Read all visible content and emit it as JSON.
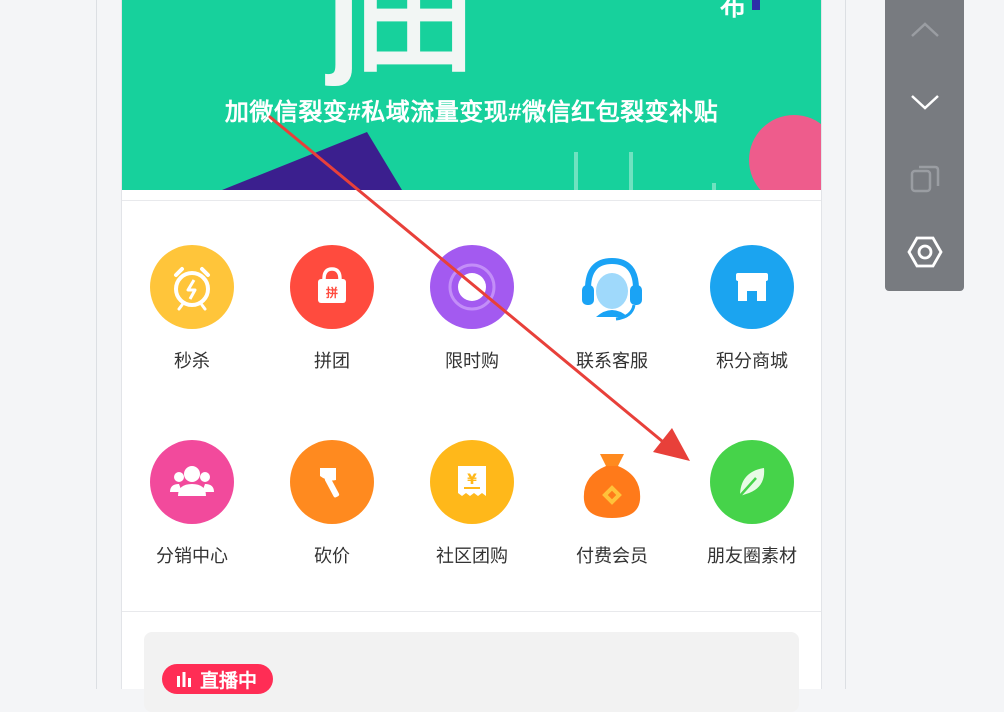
{
  "banner": {
    "big_text": "j田",
    "corner_text": "布",
    "tagline": "加微信裂变#私域流量变现#微信红包裂变补贴"
  },
  "grid": [
    {
      "label": "秒杀",
      "icon": "alarm-clock-icon",
      "color": "#ffc53a"
    },
    {
      "label": "拼团",
      "icon": "shopping-bag-icon",
      "color": "#ff4b3e"
    },
    {
      "label": "限时购",
      "icon": "clock-icon",
      "color": "#a35af0"
    },
    {
      "label": "联系客服",
      "icon": "headset-icon",
      "color": "#1aa3f5"
    },
    {
      "label": "积分商城",
      "icon": "store-icon",
      "color": "#1ba4f0"
    },
    {
      "label": "分销中心",
      "icon": "users-icon",
      "color": "#f24a9c"
    },
    {
      "label": "砍价",
      "icon": "axe-icon",
      "color": "#ff8a1f"
    },
    {
      "label": "社区团购",
      "icon": "receipt-icon",
      "color": "#ffb81a"
    },
    {
      "label": "付费会员",
      "icon": "money-bag-icon",
      "color": "#ff7a1a"
    },
    {
      "label": "朋友圈素材",
      "icon": "feather-icon",
      "color": "#46d34a"
    }
  ],
  "live": {
    "badge_label": "直播中",
    "badge_icon": "bar-chart-icon"
  },
  "toolbar": {
    "buttons": [
      "chevron-up-icon",
      "chevron-down-icon",
      "copy-icon",
      "settings-hexagon-icon"
    ]
  },
  "colors": {
    "banner": "#17d19c",
    "arrow": "#e8403a",
    "toolbar": "#787b80",
    "live_badge": "#ff2d55"
  }
}
